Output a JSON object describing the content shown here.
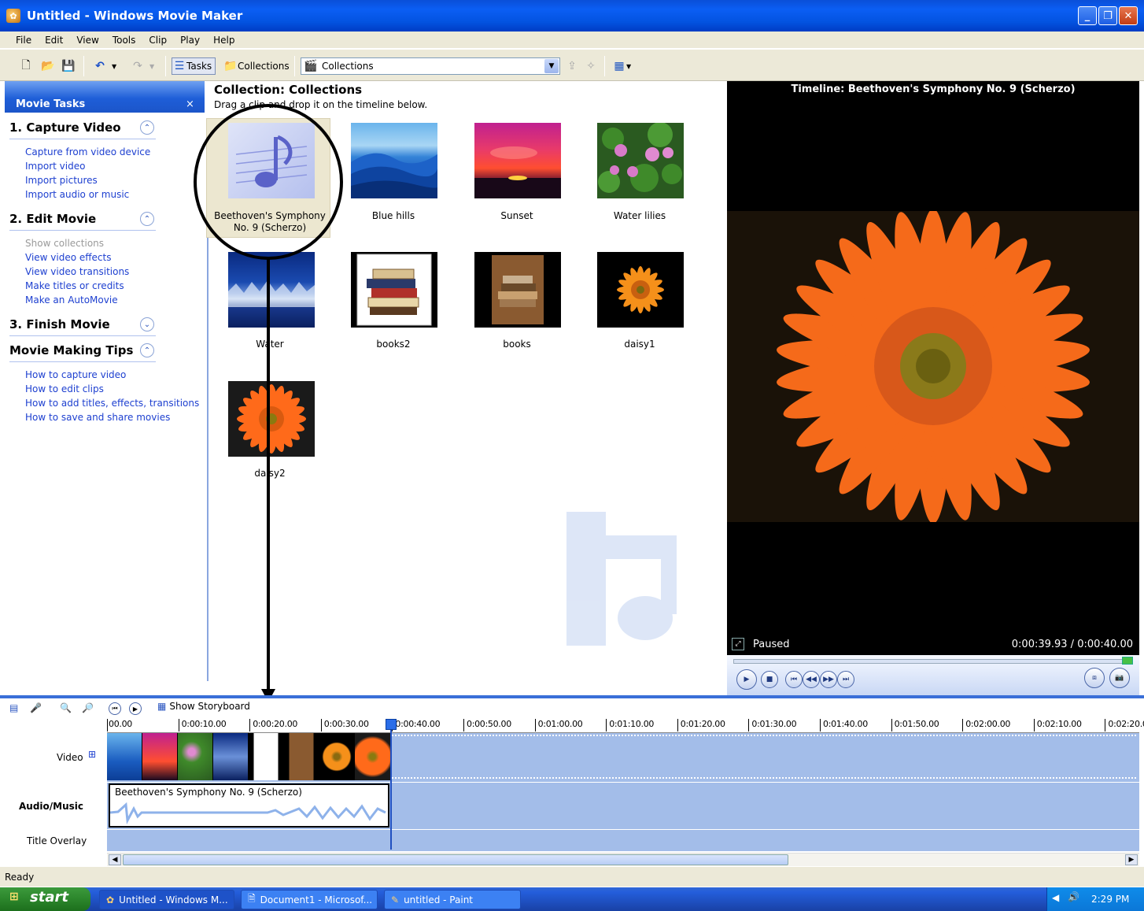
{
  "window": {
    "title": "Untitled - Windows Movie Maker"
  },
  "menu": [
    "File",
    "Edit",
    "View",
    "Tools",
    "Clip",
    "Play",
    "Help"
  ],
  "toolbar": {
    "tasks_label": "Tasks",
    "collections_label": "Collections",
    "collection_select": "Collections"
  },
  "tasks": {
    "header": "Movie Tasks",
    "close": "×",
    "sections": [
      {
        "title": "1. Capture Video",
        "links": [
          "Capture from video device",
          "Import video",
          "Import pictures",
          "Import audio or music"
        ]
      },
      {
        "title": "2. Edit Movie",
        "links": [
          "Show collections",
          "View video effects",
          "View video transitions",
          "Make titles or credits",
          "Make an AutoMovie"
        ]
      },
      {
        "title": "3. Finish Movie",
        "links": []
      },
      {
        "title": "Movie Making Tips",
        "links": [
          "How to capture video",
          "How to edit clips",
          "How to add titles, effects, transitions",
          "How to save and share movies"
        ]
      }
    ]
  },
  "collection": {
    "title": "Collection: Collections",
    "subtitle": "Drag a clip and drop it on the timeline below.",
    "items": [
      {
        "label": "Beethoven's Symphony No. 9 (Scherzo)",
        "kind": "music-note-icon",
        "selected": true
      },
      {
        "label": "Blue hills",
        "kind": "blue-hills"
      },
      {
        "label": "Sunset",
        "kind": "sunset"
      },
      {
        "label": "Water lilies",
        "kind": "water-lilies"
      },
      {
        "label": "Water",
        "kind": "water"
      },
      {
        "label": "books2",
        "kind": "books2"
      },
      {
        "label": "books",
        "kind": "books"
      },
      {
        "label": "daisy1",
        "kind": "daisy"
      },
      {
        "label": "daisy2",
        "kind": "daisy"
      }
    ]
  },
  "preview": {
    "title": "Timeline: Beethoven's Symphony No. 9 (Scherzo)",
    "status": "Paused",
    "time": "0:00:39.93 / 0:00:40.00"
  },
  "timeline": {
    "show_storyboard": "Show Storyboard",
    "ticks": [
      "00.00",
      "0:00:10.00",
      "0:00:20.00",
      "0:00:30.00",
      "0:00:40.00",
      "0:00:50.00",
      "0:01:00.00",
      "0:01:10.00",
      "0:01:20.00",
      "0:01:30.00",
      "0:01:40.00",
      "0:01:50.00",
      "0:02:00.00",
      "0:02:10.00",
      "0:02:20.00"
    ],
    "tracks": {
      "video": "Video",
      "audio": "Audio/Music",
      "overlay": "Title Overlay"
    },
    "expand": "⊞",
    "audio_clip": "Beethoven's Symphony No. 9 (Scherzo)"
  },
  "status": "Ready",
  "taskbar": {
    "start": "start",
    "tasks": [
      "Untitled - Windows M...",
      "Document1 - Microsof...",
      "untitled - Paint"
    ],
    "clock": "2:29 PM"
  },
  "colors": {
    "xp_blue": "#0b5ef4",
    "track": "#a3bde9",
    "link": "#1e40d0"
  }
}
